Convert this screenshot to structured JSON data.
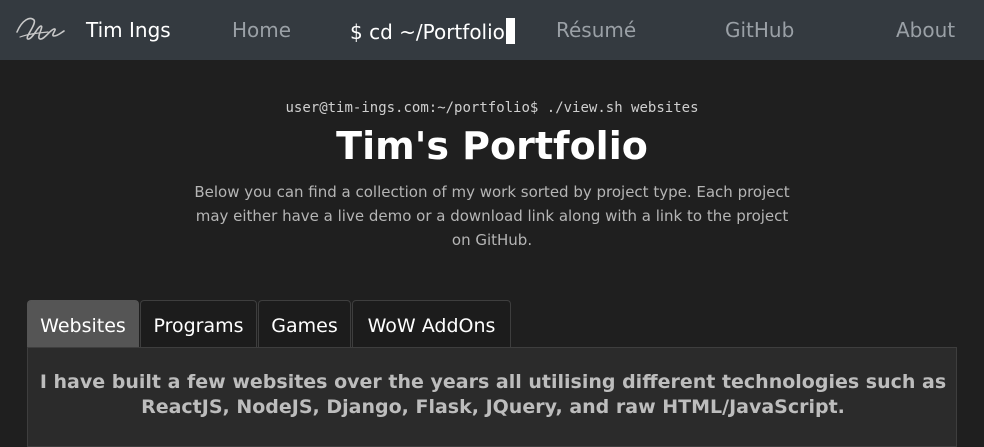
{
  "navbar": {
    "brand": "Tim Ings",
    "links": [
      {
        "label": "Home"
      },
      {
        "label": "$ cd ~/Portfolio"
      },
      {
        "label": "Résumé"
      },
      {
        "label": "GitHub"
      },
      {
        "label": "About"
      }
    ]
  },
  "header": {
    "terminal": "user@tim-ings.com:~/portfolio$ ./view.sh websites",
    "title": "Tim's Portfolio",
    "intro": "Below you can find a collection of my work sorted by project type. Each project may either have a live demo or a download link along with a link to the project on GitHub."
  },
  "tabs": [
    {
      "label": "Websites"
    },
    {
      "label": "Programs"
    },
    {
      "label": "Games"
    },
    {
      "label": "WoW AddOns"
    }
  ],
  "panel": {
    "text": "I have built a few websites over the years all utilising different technologies such as ReactJS, NodeJS, Django, Flask, JQuery, and raw HTML/JavaScript."
  },
  "colors": {
    "navbar": "#343a40",
    "background": "#1f1f1f",
    "tab_active": "#555555",
    "panel": "#2b2b2b"
  },
  "icons": {
    "logo": "signature-logo"
  }
}
